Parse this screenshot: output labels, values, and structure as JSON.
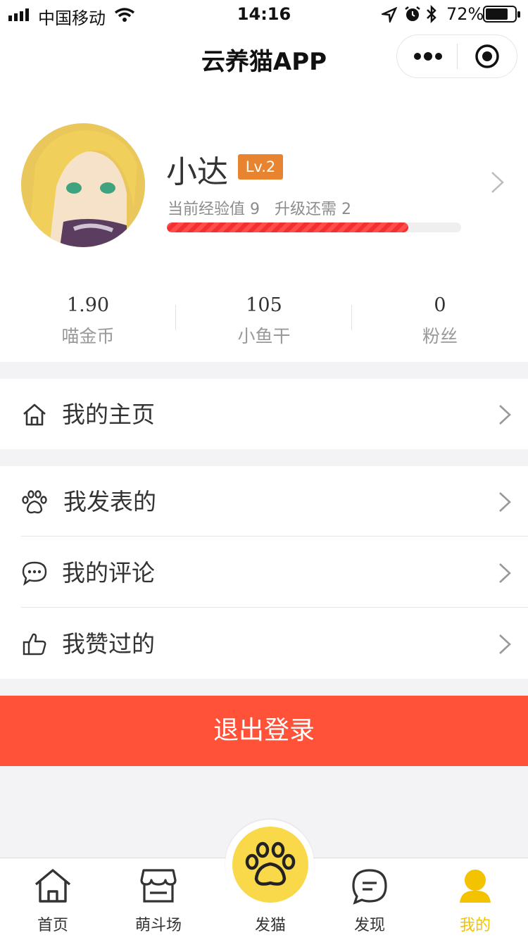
{
  "status_bar": {
    "carrier": "中国移动",
    "time": "14:16",
    "battery_pct": "72%"
  },
  "nav": {
    "title": "云养猫APP"
  },
  "profile": {
    "name": "小达",
    "level": "Lv.2",
    "exp_text": "当前经验值 9   升级还需 2",
    "exp_progress": 0.82
  },
  "stats": [
    {
      "value": "1.90",
      "label": "喵金币"
    },
    {
      "value": "105",
      "label": "小鱼干"
    },
    {
      "value": "0",
      "label": "粉丝"
    }
  ],
  "menu": {
    "home": {
      "label": "我的主页",
      "icon": "home-icon"
    },
    "posts": {
      "label": "我发表的",
      "icon": "paw-icon"
    },
    "comments": {
      "label": "我的评论",
      "icon": "chat-bubble-icon"
    },
    "likes": {
      "label": "我赞过的",
      "icon": "thumbs-up-icon"
    }
  },
  "logout_label": "退出登录",
  "tabs": [
    {
      "label": "首页",
      "icon": "home-icon"
    },
    {
      "label": "萌斗场",
      "icon": "store-icon"
    },
    {
      "label": "发猫",
      "icon": "paw-icon"
    },
    {
      "label": "发现",
      "icon": "message-icon"
    },
    {
      "label": "我的",
      "icon": "user-icon"
    }
  ],
  "colors": {
    "accent": "#f4c300",
    "logout": "#ff5238",
    "level_badge": "#e8832f",
    "progress": "#f23030"
  }
}
